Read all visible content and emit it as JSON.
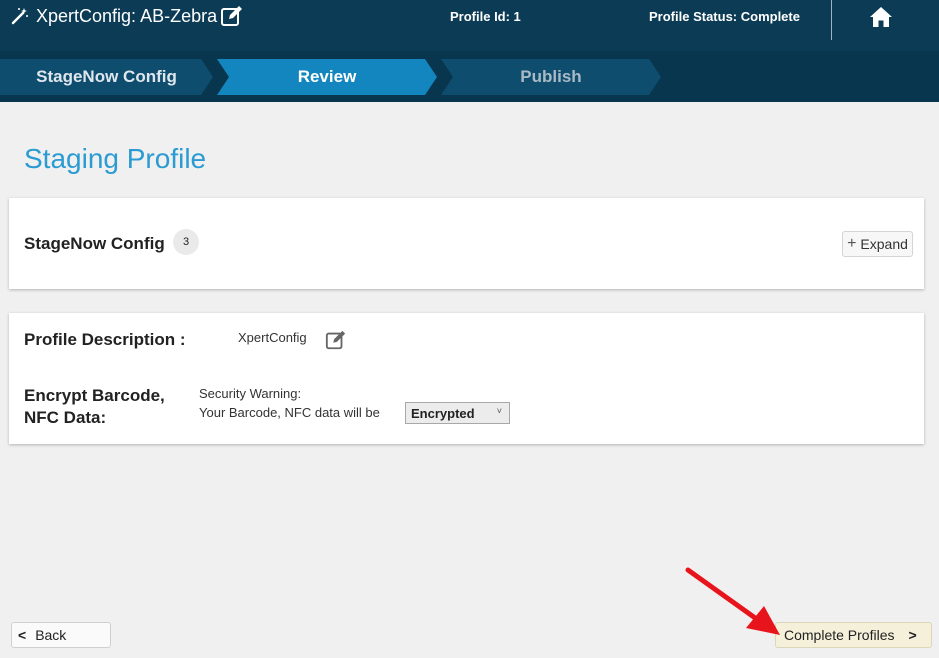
{
  "header": {
    "app_title": "XpertConfig: AB-Zebra",
    "profile_id": "Profile Id: 1",
    "profile_status": "Profile Status: Complete",
    "icons": [
      "magic-wand-icon",
      "edit-icon",
      "home-icon"
    ]
  },
  "steps": [
    {
      "label": "StageNow Config",
      "state": "done"
    },
    {
      "label": "Review",
      "state": "active"
    },
    {
      "label": "Publish",
      "state": "pending"
    }
  ],
  "page_title": "Staging Profile",
  "stagenow_section": {
    "title": "StageNow Config",
    "count": "3",
    "expand_label": "Expand"
  },
  "profile": {
    "description_label": "Profile Description :",
    "description_value": "XpertConfig",
    "encrypt_label": "Encrypt Barcode, NFC Data:",
    "warning_line1": "Security Warning:",
    "warning_line2": "Your Barcode, NFC data will be",
    "encrypt_selected": "Encrypted"
  },
  "footer": {
    "back_label": "Back",
    "complete_label": "Complete Profiles"
  },
  "colors": {
    "header_bg": "#0c3b55",
    "step_active": "#1386c0",
    "step_inactive": "#0f4d6e",
    "title_blue": "#2a9bd3",
    "annotation_red": "#e8141c"
  }
}
